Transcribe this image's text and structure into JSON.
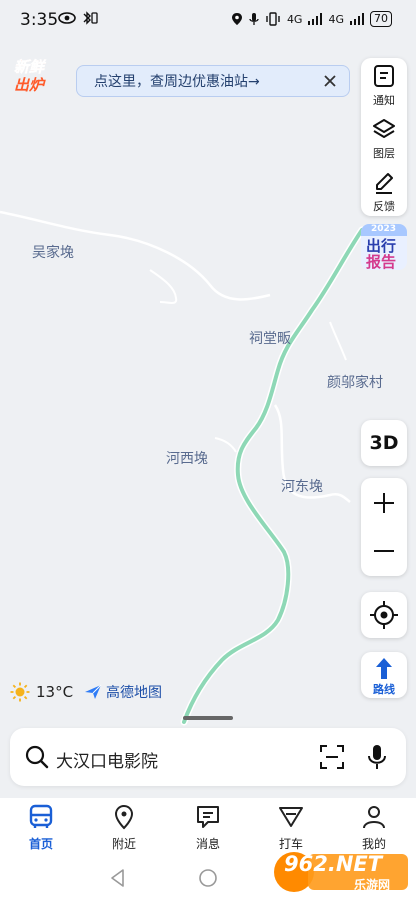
{
  "status_bar": {
    "time": "3:35",
    "battery": "70",
    "network_1": "4G",
    "network_2": "4G"
  },
  "promo_badge": {
    "line1": "新鲜",
    "line2": "出炉"
  },
  "banner": {
    "text": "点这里，查周边优惠油站→"
  },
  "side_panel": {
    "notify_label": "通知",
    "layers_label": "图层",
    "feedback_label": "反馈"
  },
  "report_badge": {
    "year": "2023",
    "line1": "出行",
    "line2": "报告"
  },
  "map": {
    "places": [
      "吴家堍",
      "祠堂畈",
      "颜邬家村",
      "河西堍",
      "河东堍"
    ]
  },
  "controls": {
    "three_d_label": "3D",
    "route_label": "路线"
  },
  "weather": {
    "temp": "13°C",
    "icon": "sun-icon"
  },
  "brand": {
    "name": "高德地图"
  },
  "search": {
    "query": "大汉口电影院"
  },
  "tabs": [
    {
      "label": "首页",
      "icon": "bus-icon",
      "active": true
    },
    {
      "label": "附近",
      "icon": "location-pin-icon",
      "active": false
    },
    {
      "label": "消息",
      "icon": "message-icon",
      "active": false
    },
    {
      "label": "打车",
      "icon": "taxi-icon",
      "active": false
    },
    {
      "label": "我的",
      "icon": "profile-icon",
      "active": false
    }
  ],
  "watermark": {
    "brand": "962.NET",
    "sub": "乐游网"
  },
  "colors": {
    "accent": "#1a5fd6",
    "road": "#8ed8b6",
    "map_bg": "#eef0f3"
  }
}
